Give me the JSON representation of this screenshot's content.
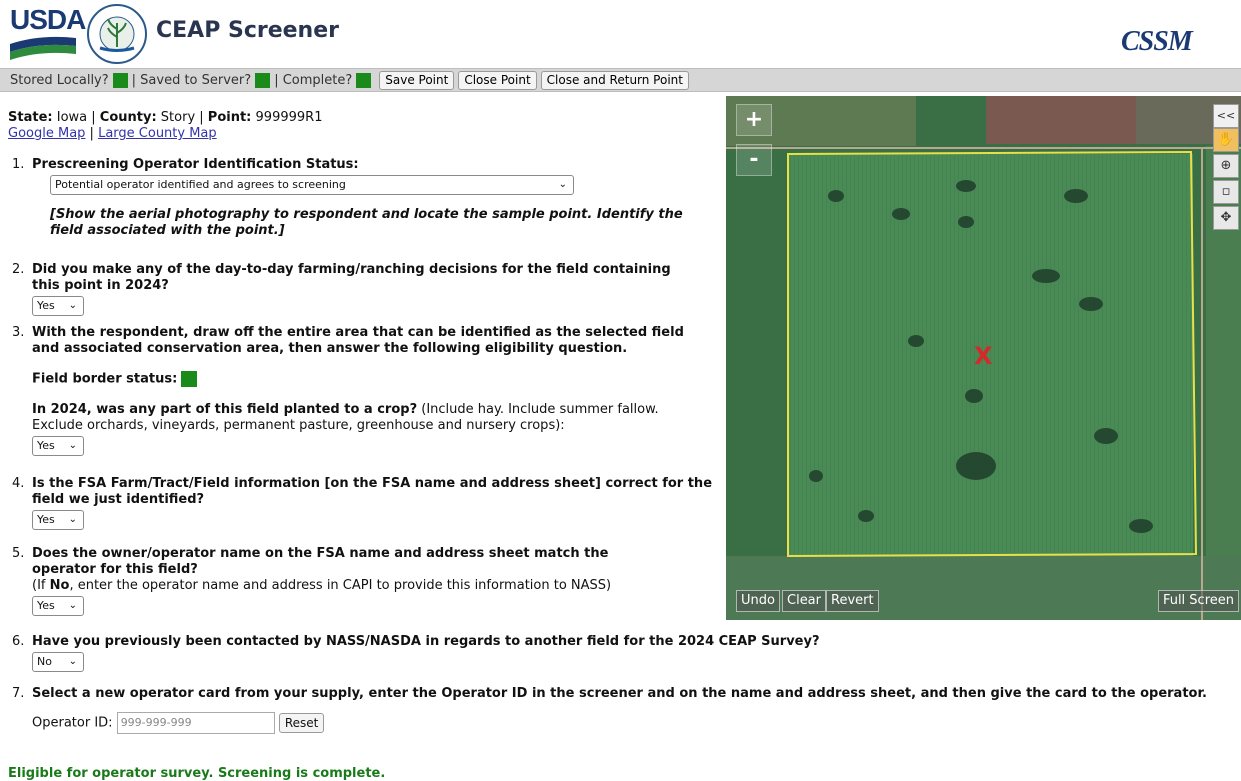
{
  "header": {
    "usda_logo": "USDA",
    "seal_text": "AGRICULTURE COUNTS",
    "app_title": "CEAP Screener",
    "cssm_logo": "CSSM"
  },
  "toolbar": {
    "stored_locally": "Stored Locally?",
    "saved_to_server": "| Saved to Server?",
    "complete": "| Complete?",
    "save_point": "Save Point",
    "close_point": "Close Point",
    "close_return": "Close and Return Point",
    "status_color": "#1a8a1a"
  },
  "location": {
    "state_label": "State:",
    "state_value": "Iowa",
    "county_label": "County:",
    "county_value": "Story",
    "point_label": "Point:",
    "point_value": "999999R1",
    "google_map": "Google Map",
    "large_county_map": "Large County Map"
  },
  "q1": {
    "num": "1.",
    "text": "Prescreening Operator Identification Status:",
    "selected": "Potential operator identified and agrees to screening",
    "note": "[Show the aerial photography to respondent and locate the sample point. Identify the field associated with the point.]"
  },
  "q2": {
    "num": "2.",
    "text": "Did you make any of the day-to-day farming/ranching decisions for the field containing this point in 2024?",
    "selected": "Yes"
  },
  "q3": {
    "num": "3.",
    "text": "With the respondent, draw off the entire area that can be identified as the selected field and associated conservation area, then answer the following eligibility question.",
    "border_label": "Field border status:",
    "crop_q": "In 2024, was any part of this field planted to a crop?",
    "crop_note": "(Include hay. Include summer fallow. Exclude orchards, vineyards, permanent pasture, greenhouse and nursery crops):",
    "selected": "Yes"
  },
  "q4": {
    "num": "4.",
    "text": "Is the FSA Farm/Tract/Field information [on the FSA name and address sheet] correct for the field we just identified?",
    "selected": "Yes"
  },
  "q5": {
    "num": "5.",
    "text": "Does the owner/operator name on the FSA name and address sheet match the operator for this field?",
    "note_pre": "(If ",
    "note_bold": "No",
    "note_post": ", enter the operator name and address in CAPI to provide this information to NASS)",
    "selected": "Yes"
  },
  "q6": {
    "num": "6.",
    "text": "Have you previously been contacted by NASS/NASDA in regards to another field for the 2024 CEAP Survey?",
    "selected": "No"
  },
  "q7": {
    "num": "7.",
    "text": "Select a new operator card from your supply, enter the Operator ID in the screener and on the name and address sheet, and then give the card to the operator.",
    "operator_label": "Operator ID:",
    "operator_placeholder": "999-999-999",
    "reset": "Reset"
  },
  "status_message": "Eligible for operator survey. Screening is complete.",
  "map": {
    "zoom_in": "+",
    "zoom_out": "-",
    "collapse": "<<",
    "undo": "Undo",
    "clear": "Clear",
    "revert": "Revert",
    "full_screen": "Full Screen",
    "point_marker": "X",
    "field_boundary_color": "#e8e04a",
    "marker_color": "#d42a2a",
    "tools": [
      "hand-icon",
      "zoom-box-icon",
      "polygon-icon",
      "move-icon"
    ]
  }
}
